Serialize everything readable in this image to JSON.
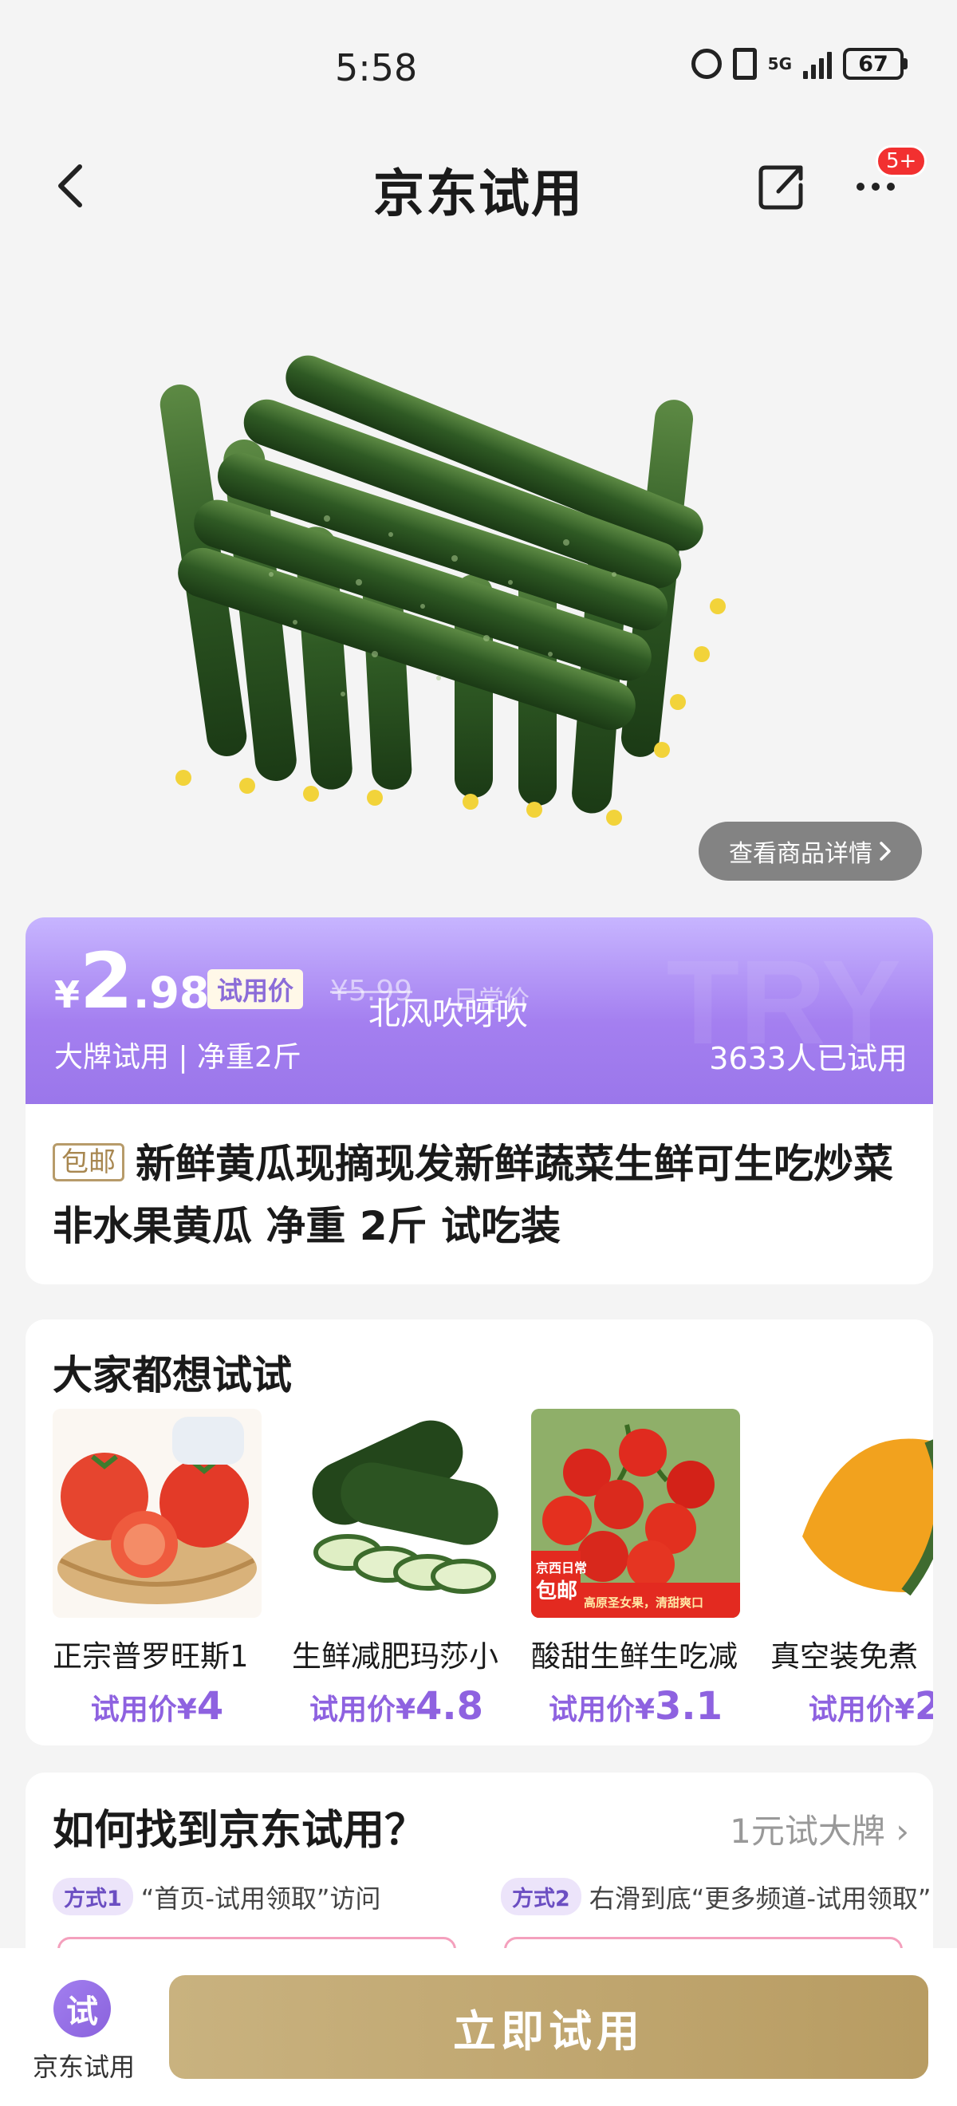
{
  "status_bar": {
    "time": "5:58",
    "network": "5G",
    "battery": "67"
  },
  "header": {
    "title": "京东试用",
    "message_badge": "5+"
  },
  "product": {
    "image": "cucumbers-photo",
    "detail_button": "查看商品详情",
    "price_currency": "¥",
    "price_int": "2",
    "price_dec": ".98",
    "trial_tag": "试用价",
    "original_price": "¥5.99",
    "original_suffix": "日常价",
    "overlay_text": "北风吹呀吹",
    "brand_line": "大牌试用 | 净重2斤",
    "tried_count": "3633人已试用",
    "shipping_tag": "包邮",
    "title": "新鲜黄瓜现摘现发新鲜蔬菜生鲜可生吃炒菜非水果黄瓜 净重 2斤 试吃装"
  },
  "recommend": {
    "title": "大家都想试试",
    "items": [
      {
        "name": "正宗普罗旺斯1",
        "price_label": "试用价¥",
        "price": "4",
        "image": "tomato-basket"
      },
      {
        "name": "生鲜减肥玛莎小",
        "price_label": "试用价¥",
        "price": "4.8",
        "image": "cucumber-slices"
      },
      {
        "name": "酸甜生鲜生吃减",
        "price_label": "试用价¥",
        "price": "3.1",
        "image": "tomato-vine",
        "image_badge_top": "京西日常",
        "image_badge": "包邮",
        "image_footer": "高原圣女果，清甜爽口"
      },
      {
        "name": "真空装免煮",
        "price_label": "试用价¥",
        "price": "2",
        "image": "pumpkin"
      }
    ]
  },
  "howto": {
    "title": "如何找到京东试用？",
    "link": "1元试大牌",
    "way1_badge": "方式1",
    "way1_text": "“首页-试用领取”访问",
    "way2_badge": "方式2",
    "way2_text": "右滑到底“更多频道-试用领取”"
  },
  "bottom_bar": {
    "home_icon_char": "试",
    "home_label": "京东试用",
    "try_button": "立即试用"
  },
  "colors": {
    "accent_purple": "#9a76ea",
    "gold_button": "#c9b27f",
    "badge_red": "#f23030"
  }
}
